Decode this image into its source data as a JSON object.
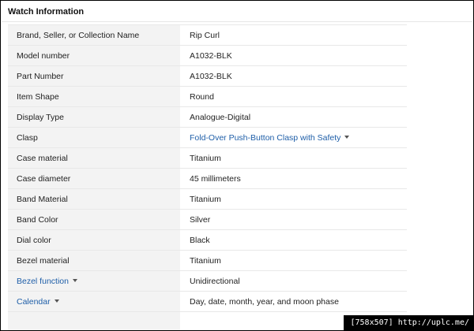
{
  "section_title": "Watch Information",
  "rows": [
    {
      "label": "Brand, Seller, or Collection Name",
      "value": "Rip Curl"
    },
    {
      "label": "Model number",
      "value": "A1032-BLK"
    },
    {
      "label": "Part Number",
      "value": "A1032-BLK"
    },
    {
      "label": "Item Shape",
      "value": "Round"
    },
    {
      "label": "Display Type",
      "value": "Analogue-Digital"
    },
    {
      "label": "Clasp",
      "value": "Fold-Over Push-Button Clasp with Safety"
    },
    {
      "label": "Case material",
      "value": "Titanium"
    },
    {
      "label": "Case diameter",
      "value": "45 millimeters"
    },
    {
      "label": "Band Material",
      "value": "Titanium"
    },
    {
      "label": "Band Color",
      "value": "Silver"
    },
    {
      "label": "Dial color",
      "value": "Black"
    },
    {
      "label": "Bezel material",
      "value": "Titanium"
    },
    {
      "label": "Bezel function",
      "value": "Unidirectional"
    },
    {
      "label": "Calendar",
      "value": "Day, date, month, year, and moon phase"
    },
    {
      "label": "",
      "value": ""
    }
  ],
  "watermark": "[758x507] http://uplc.me/",
  "colors": {
    "link": "#1e5ea8",
    "label_bg": "#f3f3f3"
  },
  "icons": {
    "dropdown": "caret-down-icon"
  }
}
